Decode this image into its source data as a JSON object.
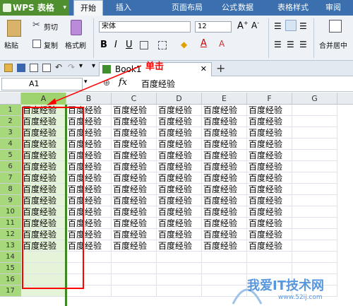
{
  "app": {
    "title": "WPS 表格"
  },
  "menu": {
    "tabs": [
      "开始",
      "插入",
      "页面布局",
      "公式",
      "数据",
      "表格样式",
      "审阅"
    ],
    "active": 0
  },
  "ribbon": {
    "cut": "剪切",
    "copy": "复制",
    "paste": "粘贴",
    "format_painter": "格式刷",
    "font": "宋体",
    "size": "12",
    "merge": "合并居中"
  },
  "doc_tab": {
    "name": "Book1"
  },
  "formula_bar": {
    "cell_ref": "A1",
    "value": "百度经验"
  },
  "sheet": {
    "columns": [
      "A",
      "B",
      "C",
      "D",
      "E",
      "F",
      "G"
    ],
    "rows": [
      "1",
      "2",
      "3",
      "4",
      "5",
      "6",
      "7",
      "8",
      "9",
      "10",
      "11",
      "12",
      "13",
      "14",
      "15",
      "16",
      "17"
    ],
    "filled_rows": 13,
    "cell_text": "百度经验"
  },
  "annotation": {
    "text": "单击"
  },
  "watermark": {
    "text": "我爱IT技术网",
    "url": "www.52ij.com"
  }
}
